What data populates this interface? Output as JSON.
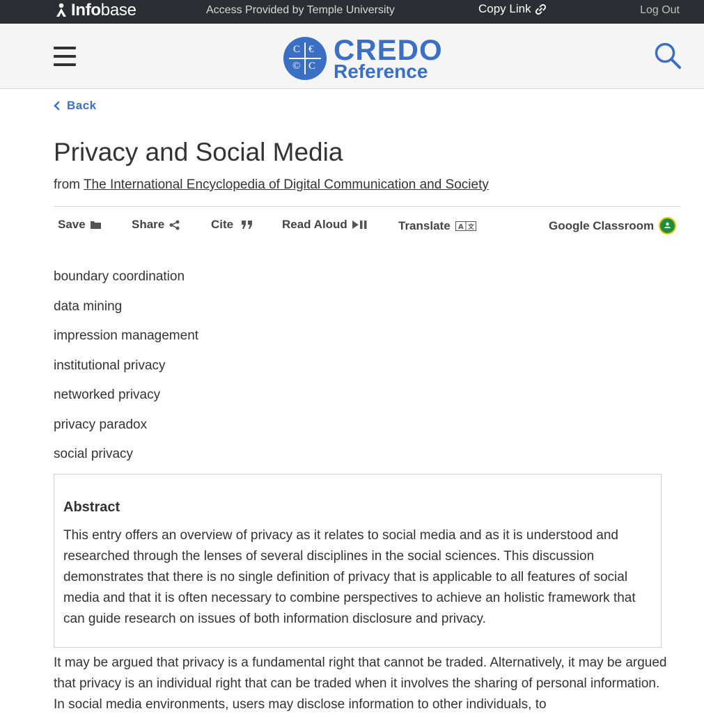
{
  "topbar": {
    "brand_bold": "Info",
    "brand_light": "base",
    "access_text": "Access Provided by Temple University",
    "copy_link": "Copy Link",
    "logout": "Log Out"
  },
  "header": {
    "logo_line1": "CREDO",
    "logo_line2": "Reference",
    "logo_glyphs": [
      "C",
      "€",
      "©",
      "C"
    ]
  },
  "nav": {
    "back": "Back"
  },
  "article": {
    "title": "Privacy and Social Media",
    "source_prefix": "from",
    "source_title": "The International Encyclopedia of Digital Communication and Society"
  },
  "toolbar": {
    "save": "Save",
    "share": "Share",
    "cite": "Cite",
    "read_aloud": "Read Aloud",
    "translate": "Translate",
    "google_classroom": "Google Classroom"
  },
  "keywords": [
    "boundary coordination",
    "data mining",
    "impression management",
    "institutional privacy",
    "networked privacy",
    "privacy paradox",
    "social privacy"
  ],
  "abstract": {
    "heading": "Abstract",
    "text": "This entry offers an overview of privacy as it relates to social media and as it is understood and researched through the lenses of several disciplines in the social sciences. This discussion demonstrates that there is no single definition of privacy that is applicable to all features of social media and that it is often necessary to combine perspectives to achieve an holistic framework that can guide research on issues of both information disclosure and privacy."
  },
  "body": {
    "paragraph1": "It may be argued that privacy is a fundamental right that cannot be traded. Alternatively, it may be argued that privacy is an individual right that can be traded when it involves the sharing of personal information. In social media environments, users may disclose information to other individuals, to"
  },
  "colors": {
    "accent": "#3a6fc4",
    "topbar": "#2b2e33",
    "header_bg": "#f5f5f5"
  }
}
